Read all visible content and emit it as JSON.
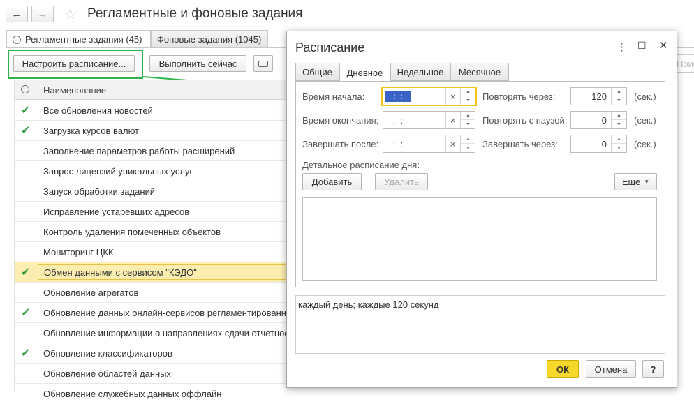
{
  "window": {
    "title": "Регламентные и фоновые задания",
    "back_icon": "←",
    "forward_icon": "→",
    "star_icon": "☆"
  },
  "tabs": [
    {
      "label": "Регламентные задания (45)"
    },
    {
      "label": "Фоновые задания (1045)"
    }
  ],
  "toolbar": {
    "schedule_button": "Настроить расписание...",
    "run_now_button": "Выполнить сейчас",
    "search_placeholder": "Поис"
  },
  "list": {
    "column_header": "Наименование",
    "rows": [
      {
        "name": "Все обновления новостей",
        "checked": true
      },
      {
        "name": "Загрузка курсов валют",
        "checked": true
      },
      {
        "name": "Заполнение параметров работы расширений",
        "checked": false
      },
      {
        "name": "Запрос лицензий уникальных услуг",
        "checked": false
      },
      {
        "name": "Запуск обработки заданий",
        "checked": false
      },
      {
        "name": "Исправление устаревших адресов",
        "checked": false
      },
      {
        "name": "Контроль удаления помеченных объектов",
        "checked": false
      },
      {
        "name": "Мониторинг ЦКК",
        "checked": false
      },
      {
        "name": "Обмен данными с сервисом \"КЭДО\"",
        "checked": true,
        "selected": true
      },
      {
        "name": "Обновление агрегатов",
        "checked": false
      },
      {
        "name": "Обновление данных онлайн-сервисов регламентированной отчетности",
        "checked": true
      },
      {
        "name": "Обновление информации о направлениях сдачи отчетности",
        "checked": false
      },
      {
        "name": "Обновление классификаторов",
        "checked": true
      },
      {
        "name": "Обновление областей данных",
        "checked": false
      },
      {
        "name": "Обновление служебных данных оффлайн",
        "checked": false
      }
    ]
  },
  "dialog": {
    "title": "Расписание",
    "menu_icon": "⋮",
    "maximize_icon": "☐",
    "close_icon": "✕",
    "tabs": [
      "Общие",
      "Дневное",
      "Недельное",
      "Месячное"
    ],
    "active_tab": "Дневное",
    "start_time_label": "Время начала:",
    "start_time_value": " :  : ",
    "end_time_label": "Время окончания:",
    "end_time_value": " :  : ",
    "finish_after_label": "Завершать после:",
    "finish_after_value": " :  : ",
    "clear_icon": "×",
    "repeat_every_label": "Повторять через:",
    "repeat_every_value": "120",
    "repeat_pause_label": "Повторять с паузой:",
    "repeat_pause_value": "0",
    "finish_in_label": "Завершать через:",
    "finish_in_value": "0",
    "unit_label": "(сек.)",
    "detail_label": "Детальное расписание дня:",
    "add_button": "Добавить",
    "delete_button": "Удалить",
    "more_button": "Еще",
    "summary": "каждый день; каждые 120 секунд",
    "ok_button": "ОК",
    "cancel_button": "Отмена",
    "help_button": "?"
  },
  "colors": {
    "highlight_border": "#2db34a",
    "selected_row": "#fbeeb0",
    "ok_button": "#f5d829",
    "focus_border": "#f0c419",
    "check": "#2a9a3d"
  }
}
